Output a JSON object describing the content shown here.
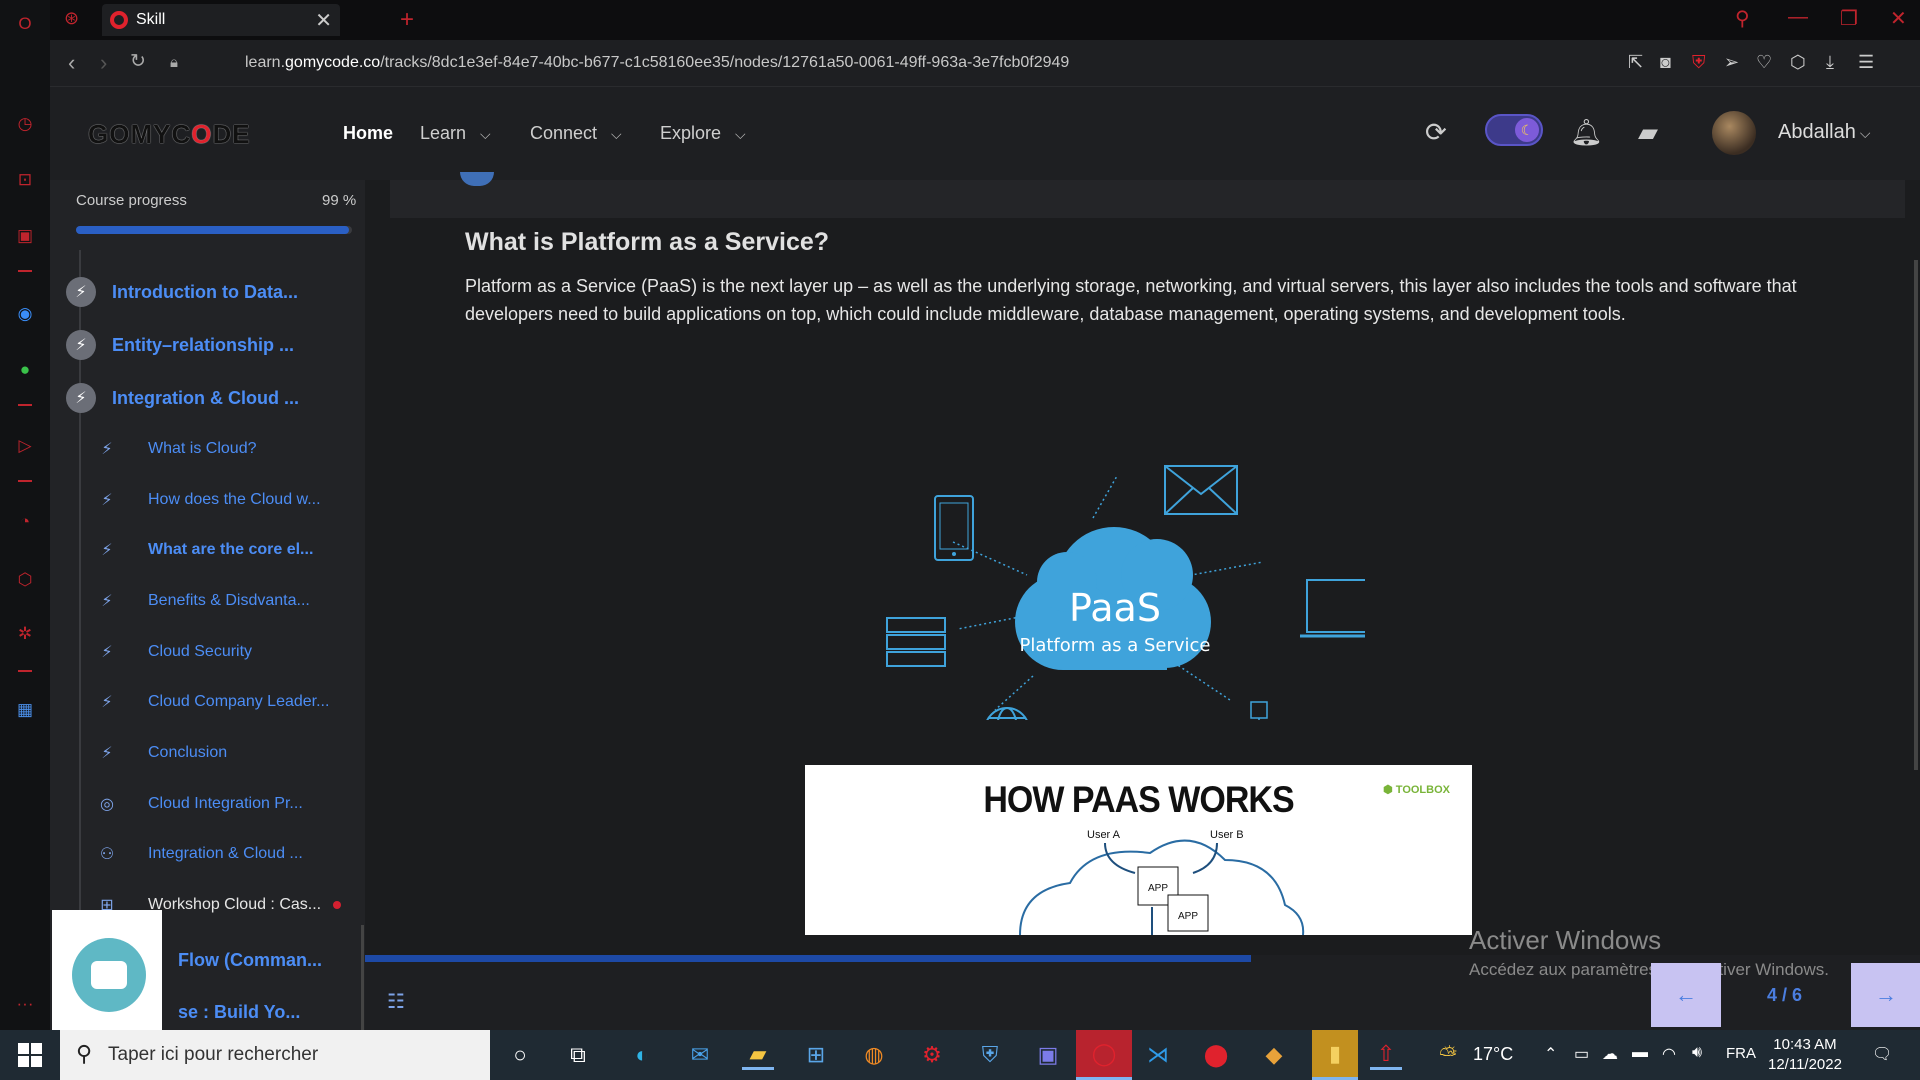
{
  "browser": {
    "tab_title": "Skill",
    "url_prefix": "learn.",
    "url_domain": "gomycode.co",
    "url_path": "/tracks/8dc1e3ef-84e7-40bc-b677-c1c58160ee35/nodes/12761a50-0061-49ff-963a-3e7fcb0f2949"
  },
  "header": {
    "logo_pre": "GOMYC",
    "logo_accent": "O",
    "logo_post": "DE",
    "nav": [
      {
        "label": "Home"
      },
      {
        "label": "Learn"
      },
      {
        "label": "Connect"
      },
      {
        "label": "Explore"
      }
    ],
    "username": "Abdallah"
  },
  "course": {
    "progress_label": "Course progress",
    "progress_value": "99 %",
    "progress_fraction": 0.99,
    "modules": [
      {
        "label": "Introduction to Data..."
      },
      {
        "label": "Entity–relationship ..."
      },
      {
        "label": "Integration & Cloud ..."
      }
    ],
    "lessons": [
      {
        "label": "What is Cloud?",
        "icon": "bolt-icon"
      },
      {
        "label": "How does the Cloud w...",
        "icon": "bolt-icon"
      },
      {
        "label": "What are the core el...",
        "icon": "bolt-icon"
      },
      {
        "label": "Benefits & Disdvanta...",
        "icon": "bolt-icon"
      },
      {
        "label": "Cloud Security",
        "icon": "bolt-icon"
      },
      {
        "label": "Cloud Company Leader...",
        "icon": "bolt-icon"
      },
      {
        "label": "Conclusion",
        "icon": "bolt-icon"
      },
      {
        "label": "Cloud Integration Pr...",
        "icon": "target-icon"
      },
      {
        "label": "Integration & Cloud ...",
        "icon": "people-icon"
      },
      {
        "label": "Workshop Cloud : Cas...",
        "icon": "workshop-icon"
      },
      {
        "label": "Flow (Comman...",
        "icon": ""
      },
      {
        "label": "se : Build Yo...",
        "icon": ""
      }
    ]
  },
  "lesson": {
    "title": "What is Platform as a Service?",
    "body": "Platform as a Service (PaaS) is the next layer up – as well as the underlying storage, networking, and virtual servers, this layer also includes the tools and software that developers need to build applications on top, which could include middleware, database management, operating systems, and development tools.",
    "diagram_title": "PaaS",
    "diagram_subtitle": "Platform as a Service",
    "image2_title": "HOW PAAS WORKS",
    "image2_logo": "TOOLBOX",
    "image2_user_a": "User A",
    "image2_user_b": "User B",
    "image2_app": "APP"
  },
  "footer": {
    "pager": "4 / 6",
    "lesson_progress_fraction": 0.57,
    "watermark_title": "Activer Windows",
    "watermark_sub": "Accédez aux paramètres pour activer Windows."
  },
  "taskbar": {
    "search_placeholder": "Taper ici pour rechercher",
    "temperature": "17°C",
    "language": "FRA",
    "time": "10:43 AM",
    "date": "12/11/2022"
  },
  "colors": {
    "accent_blue": "#4c8df5",
    "brand_red": "#e0222d",
    "cloud_blue": "#3fa3db"
  }
}
